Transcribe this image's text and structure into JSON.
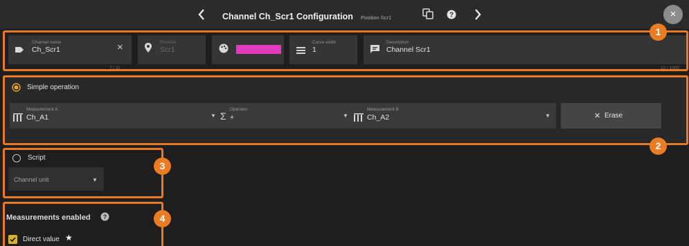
{
  "header": {
    "title": "Channel Ch_Scr1 Configuration",
    "subtitle": "Position Scr1",
    "prev_icon": "chevron-left",
    "next_icon": "chevron-right",
    "close_label": "×"
  },
  "fields": {
    "channel_name": {
      "label": "Channel name",
      "value": "Ch_Scr1",
      "counter": "7 / 11",
      "clear": "×"
    },
    "position": {
      "label": "Position",
      "value": "Scr1"
    },
    "color": {
      "value": "#e23bbd"
    },
    "curve_width": {
      "label": "Curve width",
      "value": "1"
    },
    "description": {
      "label": "Description",
      "value": "Channel Scr1",
      "counter": "12 / 1000"
    }
  },
  "simple_operation": {
    "label": "Simple operation",
    "measurement_a": {
      "label": "Measurement A",
      "value": "Ch_A1"
    },
    "operator": {
      "label": "Operator",
      "value": "+"
    },
    "measurement_b": {
      "label": "Measurement B",
      "value": "Ch_A2"
    },
    "erase_label": "Erase"
  },
  "script": {
    "label": "Script",
    "channel_unit": "Channel unit"
  },
  "measurements": {
    "title": "Measurements enabled",
    "direct_value": "Direct value"
  },
  "badges": [
    "1",
    "2",
    "3",
    "4"
  ],
  "colors": {
    "accent": "#e87a25",
    "checkbox": "#d6b52c"
  }
}
